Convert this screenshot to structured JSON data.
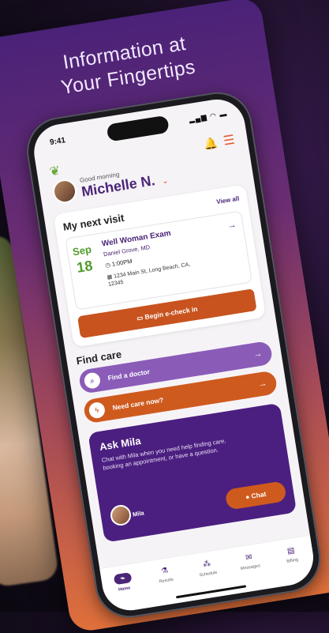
{
  "headline": [
    "Information at",
    "Your Fingertips"
  ],
  "status": {
    "time": "9:41"
  },
  "greeting": {
    "small": "Good morning",
    "name": "Michelle N."
  },
  "visit": {
    "title": "My next visit",
    "view_all": "View all",
    "month": "Sep",
    "day": "18",
    "exam": "Well Woman Exam",
    "doctor": "Daniel Grove, MD",
    "time": "1:00PM",
    "address": "1234 Main St, Long Beach, CA, 12345",
    "checkin_label": "Begin e-check in"
  },
  "find_care": {
    "title": "Find care",
    "find_doctor": "Find a doctor",
    "need_care": "Need care now?"
  },
  "mila": {
    "title": "Ask Mila",
    "text": "Chat with Mila when you need help finding care, booking an appointment, or have a question.",
    "name": "Mila",
    "chat_label": "Chat"
  },
  "tabs": [
    "Home",
    "Results",
    "Schedule",
    "Messages",
    "Billing"
  ],
  "colors": {
    "purple": "#4b2577",
    "orange": "#cf5a1e",
    "green": "#4f9b2a"
  }
}
